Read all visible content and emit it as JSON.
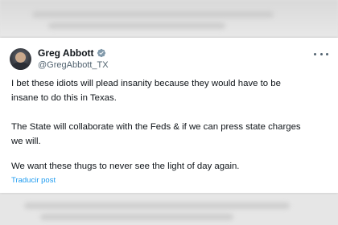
{
  "tweet": {
    "author_name": "Greg Abbott",
    "author_handle": "@GregAbbott_TX",
    "lines": [
      "I bet these idiots will plead insanity because they would have to be",
      "insane to do this in Texas.",
      "The State will collaborate with the Feds & if we can press state charges",
      "we will.",
      "We want these thugs to never see the light of day again."
    ],
    "translate_label": "Traducir post"
  },
  "colors": {
    "verified_badge": "#829aab",
    "link_blue": "#1d9bf0",
    "text_primary": "#0f1419",
    "text_secondary": "#536471"
  },
  "icons": {
    "verified": "verified-badge-icon",
    "more": "more-options-icon",
    "avatar": "avatar-photo"
  }
}
